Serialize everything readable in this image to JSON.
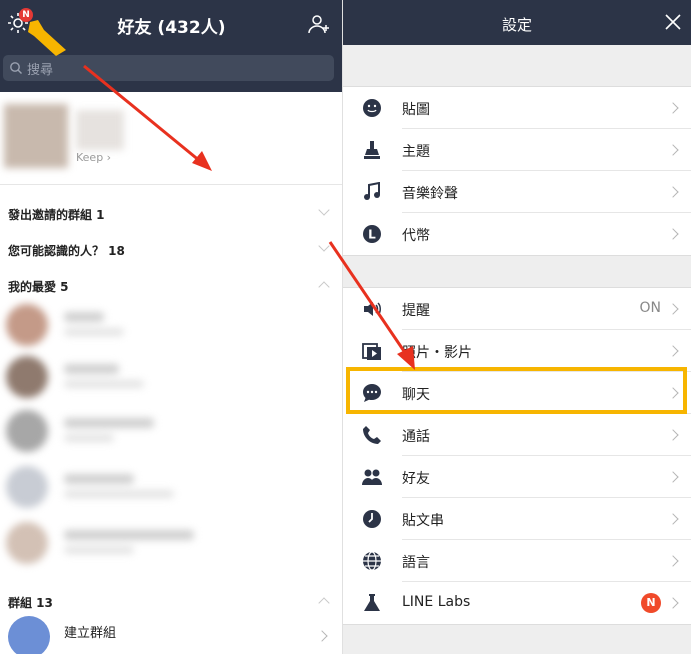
{
  "left": {
    "title": "好友 (432人)",
    "badge": "N",
    "search_placeholder": "搜尋",
    "keep_label": "Keep",
    "sections": [
      {
        "label": "發出邀請的群組 1"
      },
      {
        "label": "您可能認識的人？ 18"
      },
      {
        "label": "我的最愛 5"
      },
      {
        "label": "群組 13"
      }
    ],
    "create_group": "建立群組"
  },
  "right": {
    "title": "設定",
    "group1": [
      {
        "label": "貼圖",
        "icon": "smile-icon"
      },
      {
        "label": "主題",
        "icon": "brush-icon"
      },
      {
        "label": "音樂鈴聲",
        "icon": "music-icon"
      },
      {
        "label": "代幣",
        "icon": "coin-icon"
      }
    ],
    "group2": [
      {
        "label": "提醒",
        "icon": "speaker-icon",
        "value": "ON"
      },
      {
        "label": "照片・影片",
        "icon": "photo-icon"
      },
      {
        "label": "聊天",
        "icon": "chat-icon"
      },
      {
        "label": "通話",
        "icon": "phone-icon"
      },
      {
        "label": "好友",
        "icon": "friends-icon"
      },
      {
        "label": "貼文串",
        "icon": "clock-icon"
      },
      {
        "label": "語言",
        "icon": "globe-icon"
      },
      {
        "label": "LINE Labs",
        "icon": "flask-icon",
        "badge": "N"
      }
    ]
  },
  "colors": {
    "header": "#2c3447",
    "highlight": "#f7b500",
    "arrow": "#e8311f",
    "badge": "#f04a2a"
  }
}
